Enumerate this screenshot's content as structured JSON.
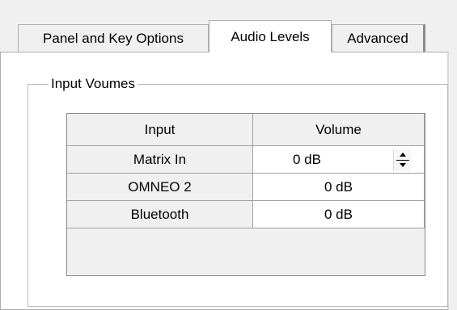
{
  "tabs": [
    {
      "label": "Panel and Key Options",
      "active": false
    },
    {
      "label": "Audio Levels",
      "active": true
    },
    {
      "label": "Advanced",
      "active": false
    }
  ],
  "group": {
    "title": "Input Voumes"
  },
  "table": {
    "headers": [
      "Input",
      "Volume"
    ],
    "rows": [
      {
        "input": "Matrix In",
        "volume": "0 dB"
      },
      {
        "input": "OMNEO 2",
        "volume": "0 dB"
      },
      {
        "input": "Bluetooth",
        "volume": "0 dB"
      }
    ]
  },
  "icons": {
    "spinner": "spin-up-down-icon"
  }
}
